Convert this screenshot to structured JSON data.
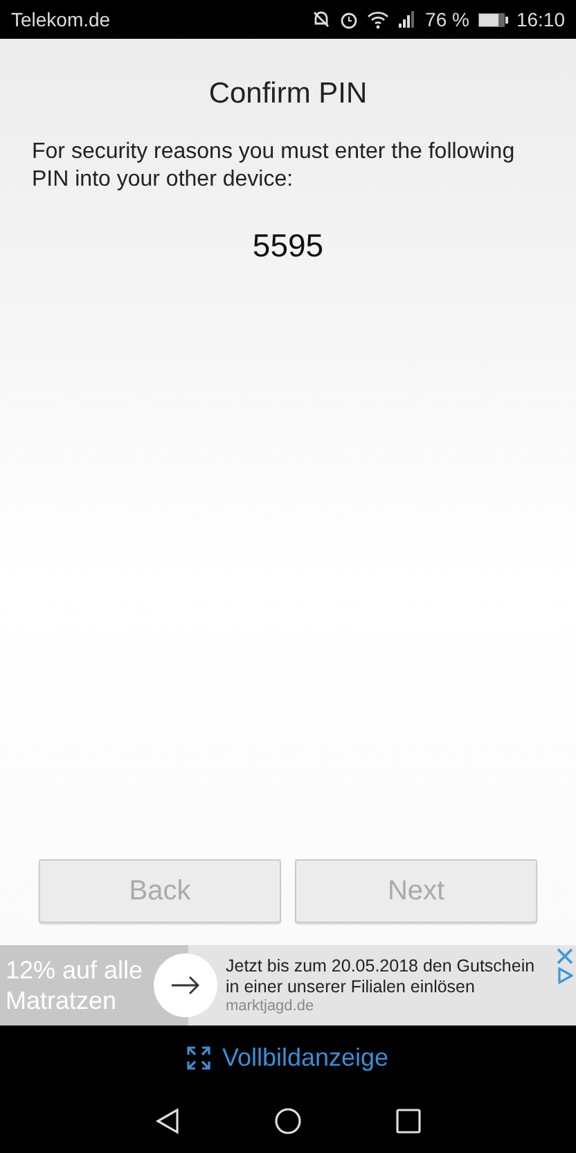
{
  "status_bar": {
    "carrier": "Telekom.de",
    "battery": "76 %",
    "time": "16:10"
  },
  "title": "Confirm PIN",
  "message": "For security reasons you must enter the following PIN into your other device:",
  "pin": "5595",
  "buttons": [
    {
      "label": "Back",
      "disabled": true
    },
    {
      "label": "Next",
      "disabled": true
    }
  ],
  "ad": {
    "headline": "12% auf alle Matratzen",
    "text": "Jetzt bis zum 20.05.2018 den Gutschein in einer unserer Filialen einlösen",
    "domain": "marktjagd.de"
  },
  "fullscreen_link": "Vollbildanzeige"
}
